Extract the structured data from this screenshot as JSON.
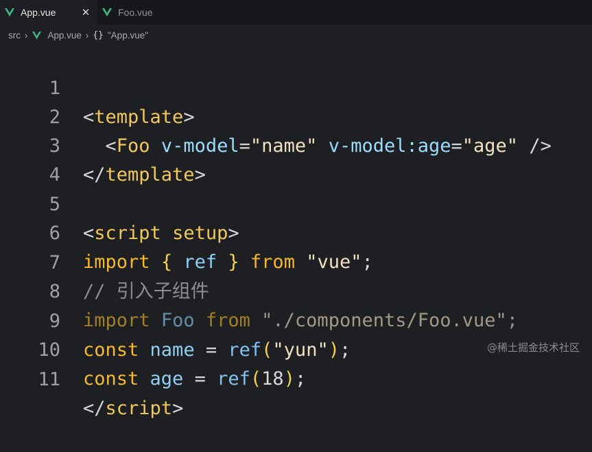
{
  "tabs": [
    {
      "label": "App.vue",
      "close": "✕"
    },
    {
      "label": "Foo.vue"
    }
  ],
  "breadcrumb": {
    "folder": "src",
    "file": "App.vue",
    "braces": "{}",
    "symbol": "\"App.vue\""
  },
  "code": {
    "line_numbers": [
      "1",
      "2",
      "3",
      "4",
      "5",
      "6",
      "7",
      "8",
      "9",
      "10",
      "11"
    ],
    "l1": {
      "open": "<",
      "tag": "template",
      "close": ">"
    },
    "l2": {
      "indent": "  ",
      "open": "<",
      "tag": "Foo",
      "attr1": "v-model",
      "eq1": "=",
      "val1": "\"name\"",
      "attr2": "v-model:age",
      "eq2": "=",
      "val2": "\"age\"",
      "selfclose": "/>"
    },
    "l3": {
      "open": "</",
      "tag": "template",
      "close": ">"
    },
    "l5": {
      "open": "<",
      "tag": "script",
      "attr": "setup",
      "close": ">"
    },
    "l6": {
      "kw": "import",
      "lb": "{",
      "id": "ref",
      "rb": "}",
      "from": "from",
      "str": "\"vue\"",
      "semi": ";"
    },
    "l7": {
      "comment": "// 引入子组件"
    },
    "l8": {
      "kw": "import",
      "id": "Foo",
      "from": "from",
      "str": "\"./components/Foo.vue\"",
      "semi": ";"
    },
    "l9": {
      "kw": "const",
      "id": "name",
      "eq": "=",
      "fn": "ref",
      "lp": "(",
      "str": "\"yun\"",
      "rp": ")",
      "semi": ";"
    },
    "l10": {
      "kw": "const",
      "id": "age",
      "eq": "=",
      "fn": "ref",
      "lp": "(",
      "num": "18",
      "rp": ")",
      "semi": ";"
    },
    "l11": {
      "open": "</",
      "tag": "script",
      "close": ">"
    }
  },
  "watermark": "@稀土掘金技术社区",
  "icons": {
    "vue": "vue-logo-icon",
    "close": "close-icon",
    "chevron": "chevron-right-icon"
  },
  "colors": {
    "vue_green": "#42b883",
    "tag": "#f2c85b",
    "keyword": "#f5b92b",
    "identifier": "#8fd0f5",
    "string": "#f0e2c1",
    "comment": "#8c8e92"
  }
}
